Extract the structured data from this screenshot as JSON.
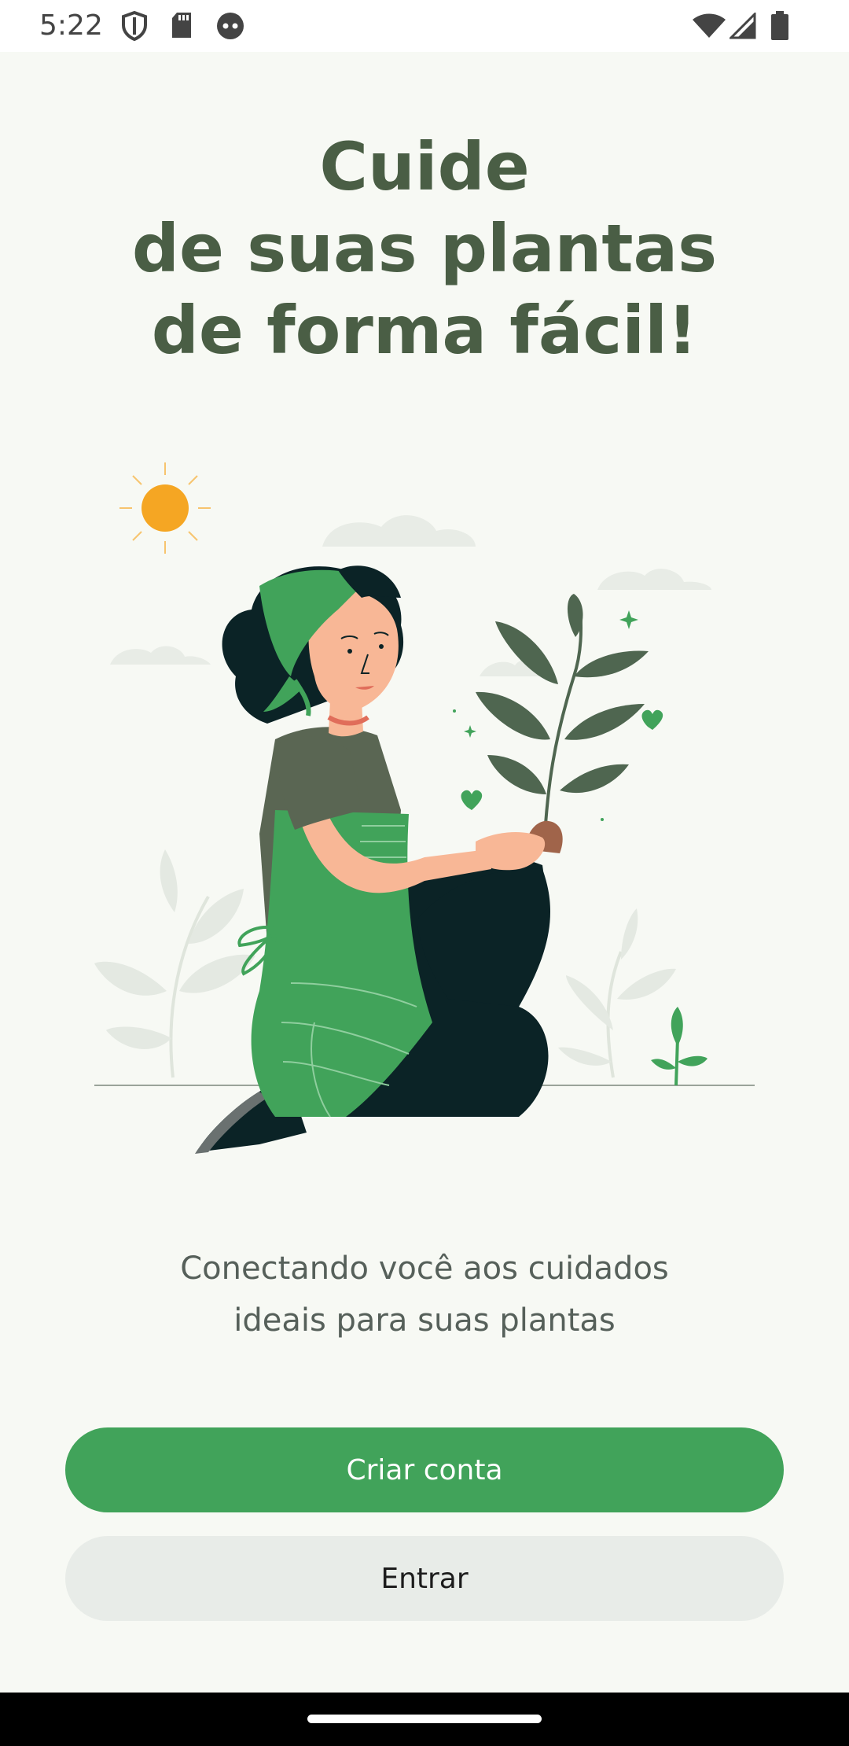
{
  "status_bar": {
    "time": "5:22",
    "icons": [
      "shield-icon",
      "sd-card-icon",
      "robot-face-icon"
    ],
    "system_icons": [
      "wifi-icon",
      "cellular-signal-icon",
      "battery-icon"
    ]
  },
  "headline": {
    "line1": "Cuide",
    "line2": "de suas plantas",
    "line3": "de forma fácil!"
  },
  "illustration": {
    "description_icon": "gardener-woman-holding-plant-illustration"
  },
  "subtitle": {
    "line1": "Conectando você aos cuidados",
    "line2": "ideais para suas plantas"
  },
  "buttons": {
    "primary": "Criar conta",
    "secondary": "Entrar"
  },
  "colors": {
    "background": "#f7f9f4",
    "headline": "#4a5e45",
    "primary": "#41a35a",
    "secondary_bg": "#e8ece8",
    "sun": "#f5a623",
    "leaf_dark": "#4f6650",
    "skin": "#f8b796",
    "hair": "#0b2326"
  }
}
